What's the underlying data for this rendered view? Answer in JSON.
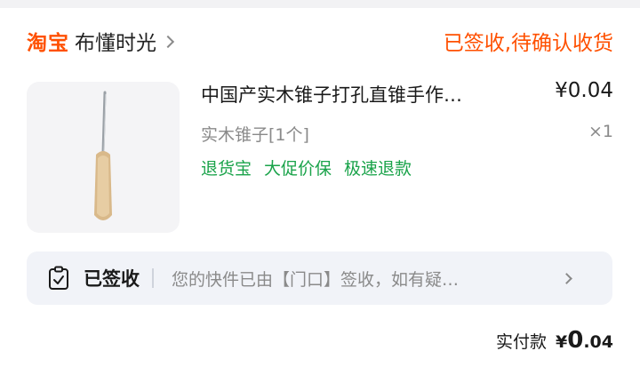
{
  "header": {
    "brand_logo": "淘宝",
    "shop_name": "布懂时光",
    "order_status": "已签收,待确认收货"
  },
  "product": {
    "title": "中国产实木锥子打孔直锥手作…",
    "price": "¥0.04",
    "sku": "实木锥子[1个]",
    "quantity": "×1",
    "services": [
      "退货宝",
      "大促价保",
      "极速退款"
    ]
  },
  "logistics": {
    "status": "已签收",
    "detail": "您的快件已由【门口】签收，如有疑…"
  },
  "total": {
    "label": "实付款",
    "currency": "¥",
    "integer": "0",
    "decimal": ".04"
  },
  "colors": {
    "brand": "#ff5000",
    "service": "#1aa34a",
    "muted": "#8a8a8a"
  },
  "icons": [
    "chevron-right-icon",
    "clipboard-check-icon"
  ]
}
